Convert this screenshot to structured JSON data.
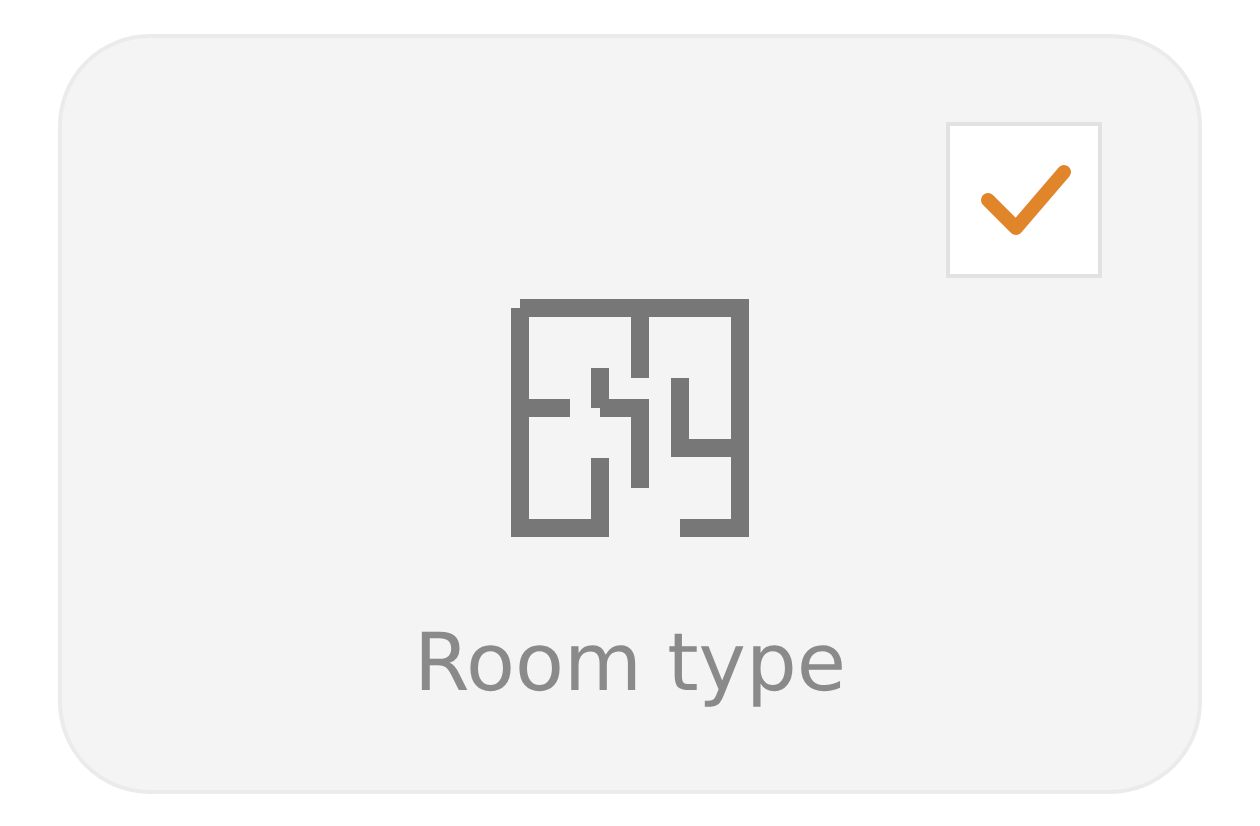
{
  "card": {
    "label": "Room type",
    "checked": true
  }
}
